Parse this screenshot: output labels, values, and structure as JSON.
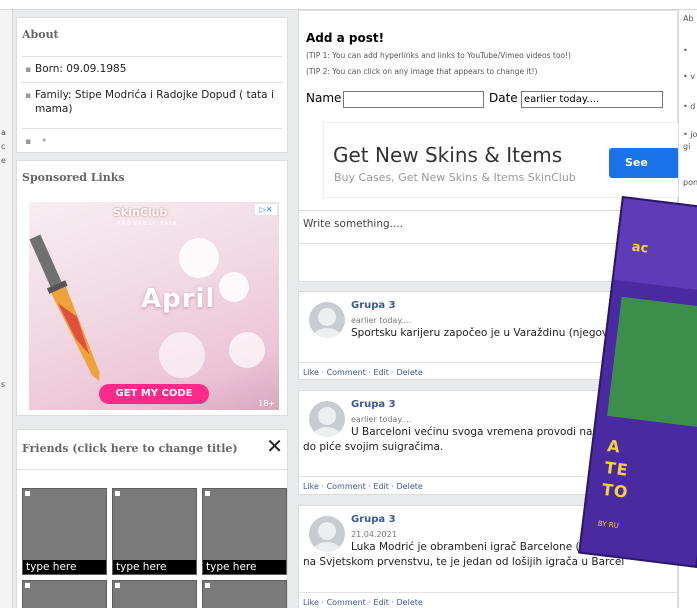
{
  "about": {
    "title": "About",
    "born": "Born: 09.09.1985",
    "family": "Family: Stipe Modrića i Radojke Dopuđ ( tata i mama)"
  },
  "sponsored": {
    "title": "Sponsored Links",
    "ad": {
      "brand": "SkinClub",
      "brand_sub": "PROVABLY FAIR",
      "headline": "April",
      "cta": "GET MY CODE",
      "age": "18+"
    }
  },
  "friends": {
    "title": "Friends (click here to change title)",
    "close": "✕",
    "tiles": [
      "type here",
      "type here",
      "type here"
    ]
  },
  "add_post": {
    "title": "Add a post!",
    "tip1": "(TIP 1: You can add hyperlinks and links to YouTube/Vimeo videos too!)",
    "tip2": "(TIP 2: You can click on any image that appears to change it!)",
    "name_label": "Name",
    "date_label": "Date",
    "date_value": "earlier today....",
    "textarea_placeholder": "Write something....",
    "ad": {
      "title": "Get New Skins & Items",
      "subtitle": "Buy Cases, Get New Skins & Items SkinClub",
      "button": "See More"
    }
  },
  "posts": [
    {
      "author": "Grupa 3",
      "date": "earlier today....",
      "text": "Sportsku karijeru započeo je u Varaždinu (njegovom rodno",
      "actions": "Like · Comment · Edit · Delete"
    },
    {
      "author": "Grupa 3",
      "date": "earlier today....",
      "text": "U Barceloni većinu svoga vremena provodi na klupi i do piće svojim suigračima.",
      "actions": "Like · Comment · Edit · Delete"
    },
    {
      "author": "Grupa 3",
      "date": "21.04.2021",
      "text": "Luka Modrić je obrambeni igrač Barcelone (Španjolsk na Svjetskom prvenstvu, te je jedan od lošijih igrača u Barcel",
      "actions": "Like · Comment · Edit · Delete"
    }
  ],
  "book_ad": {
    "brand": "ac",
    "letters": [
      "A",
      "TE",
      "TO"
    ],
    "byline": "BY RU"
  }
}
